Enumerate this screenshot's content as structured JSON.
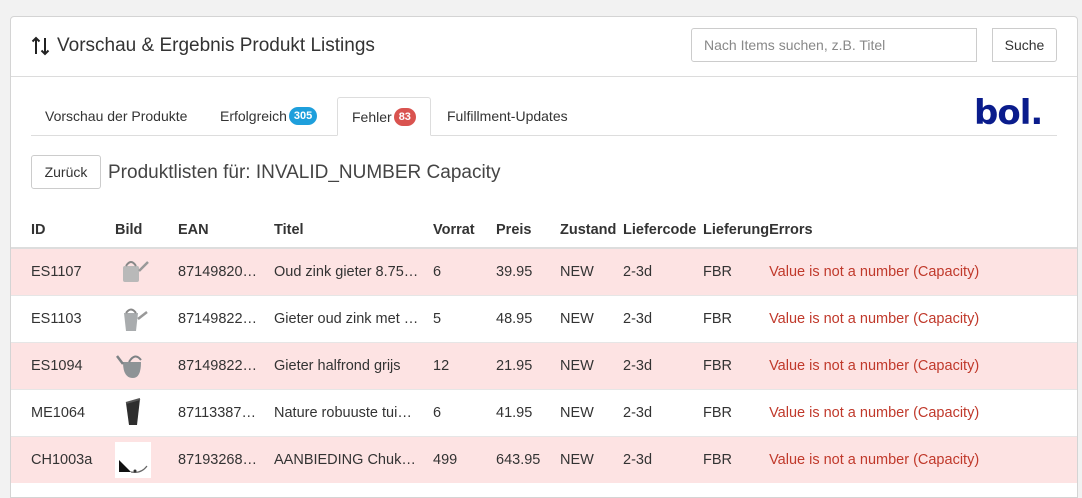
{
  "header": {
    "title": "Vorschau & Ergebnis Produkt Listings",
    "search_placeholder": "Nach Items suchen, z.B. Titel",
    "search_button": "Suche"
  },
  "tabs": [
    {
      "label": "Vorschau der Produkte"
    },
    {
      "label": "Erfolgreich",
      "badge": "305"
    },
    {
      "label": "Fehler",
      "badge": "83"
    },
    {
      "label": "Fulfillment-Updates"
    }
  ],
  "logo_text": "bol.",
  "back_button": "Zurück",
  "subtitle": "Produktlisten für: INVALID_NUMBER Capacity",
  "table": {
    "columns": [
      "ID",
      "Bild",
      "EAN",
      "Titel",
      "Vorrat",
      "Preis",
      "Zustand",
      "Liefercode",
      "Lieferung",
      "Errors"
    ],
    "rows": [
      {
        "id": "ES1107",
        "ean": "87149820…",
        "title": "Oud zink gieter 8.75…",
        "stock": "6",
        "price": "39.95",
        "condition": "NEW",
        "delivery_code": "2-3d",
        "fulfilment": "FBR",
        "error": "Value is not a number (Capacity)"
      },
      {
        "id": "ES1103",
        "ean": "87149822…",
        "title": "Gieter oud zink met …",
        "stock": "5",
        "price": "48.95",
        "condition": "NEW",
        "delivery_code": "2-3d",
        "fulfilment": "FBR",
        "error": "Value is not a number (Capacity)"
      },
      {
        "id": "ES1094",
        "ean": "87149822…",
        "title": "Gieter halfrond grijs",
        "stock": "12",
        "price": "21.95",
        "condition": "NEW",
        "delivery_code": "2-3d",
        "fulfilment": "FBR",
        "error": "Value is not a number (Capacity)"
      },
      {
        "id": "ME1064",
        "ean": "87113387…",
        "title": "Nature robuuste tui…",
        "stock": "6",
        "price": "41.95",
        "condition": "NEW",
        "delivery_code": "2-3d",
        "fulfilment": "FBR",
        "error": "Value is not a number (Capacity)"
      },
      {
        "id": "CH1003a",
        "ean": "87193268…",
        "title": "AANBIEDING Chuk…",
        "stock": "499",
        "price": "643.95",
        "condition": "NEW",
        "delivery_code": "2-3d",
        "fulfilment": "FBR",
        "error": "Value is not a number (Capacity)"
      }
    ]
  },
  "colors": {
    "error_row_bg": "#fde3e3",
    "error_text": "#c0392b",
    "badge_success": "#1e9fdc",
    "badge_error": "#d9534f",
    "logo": "#0a1c8c"
  }
}
